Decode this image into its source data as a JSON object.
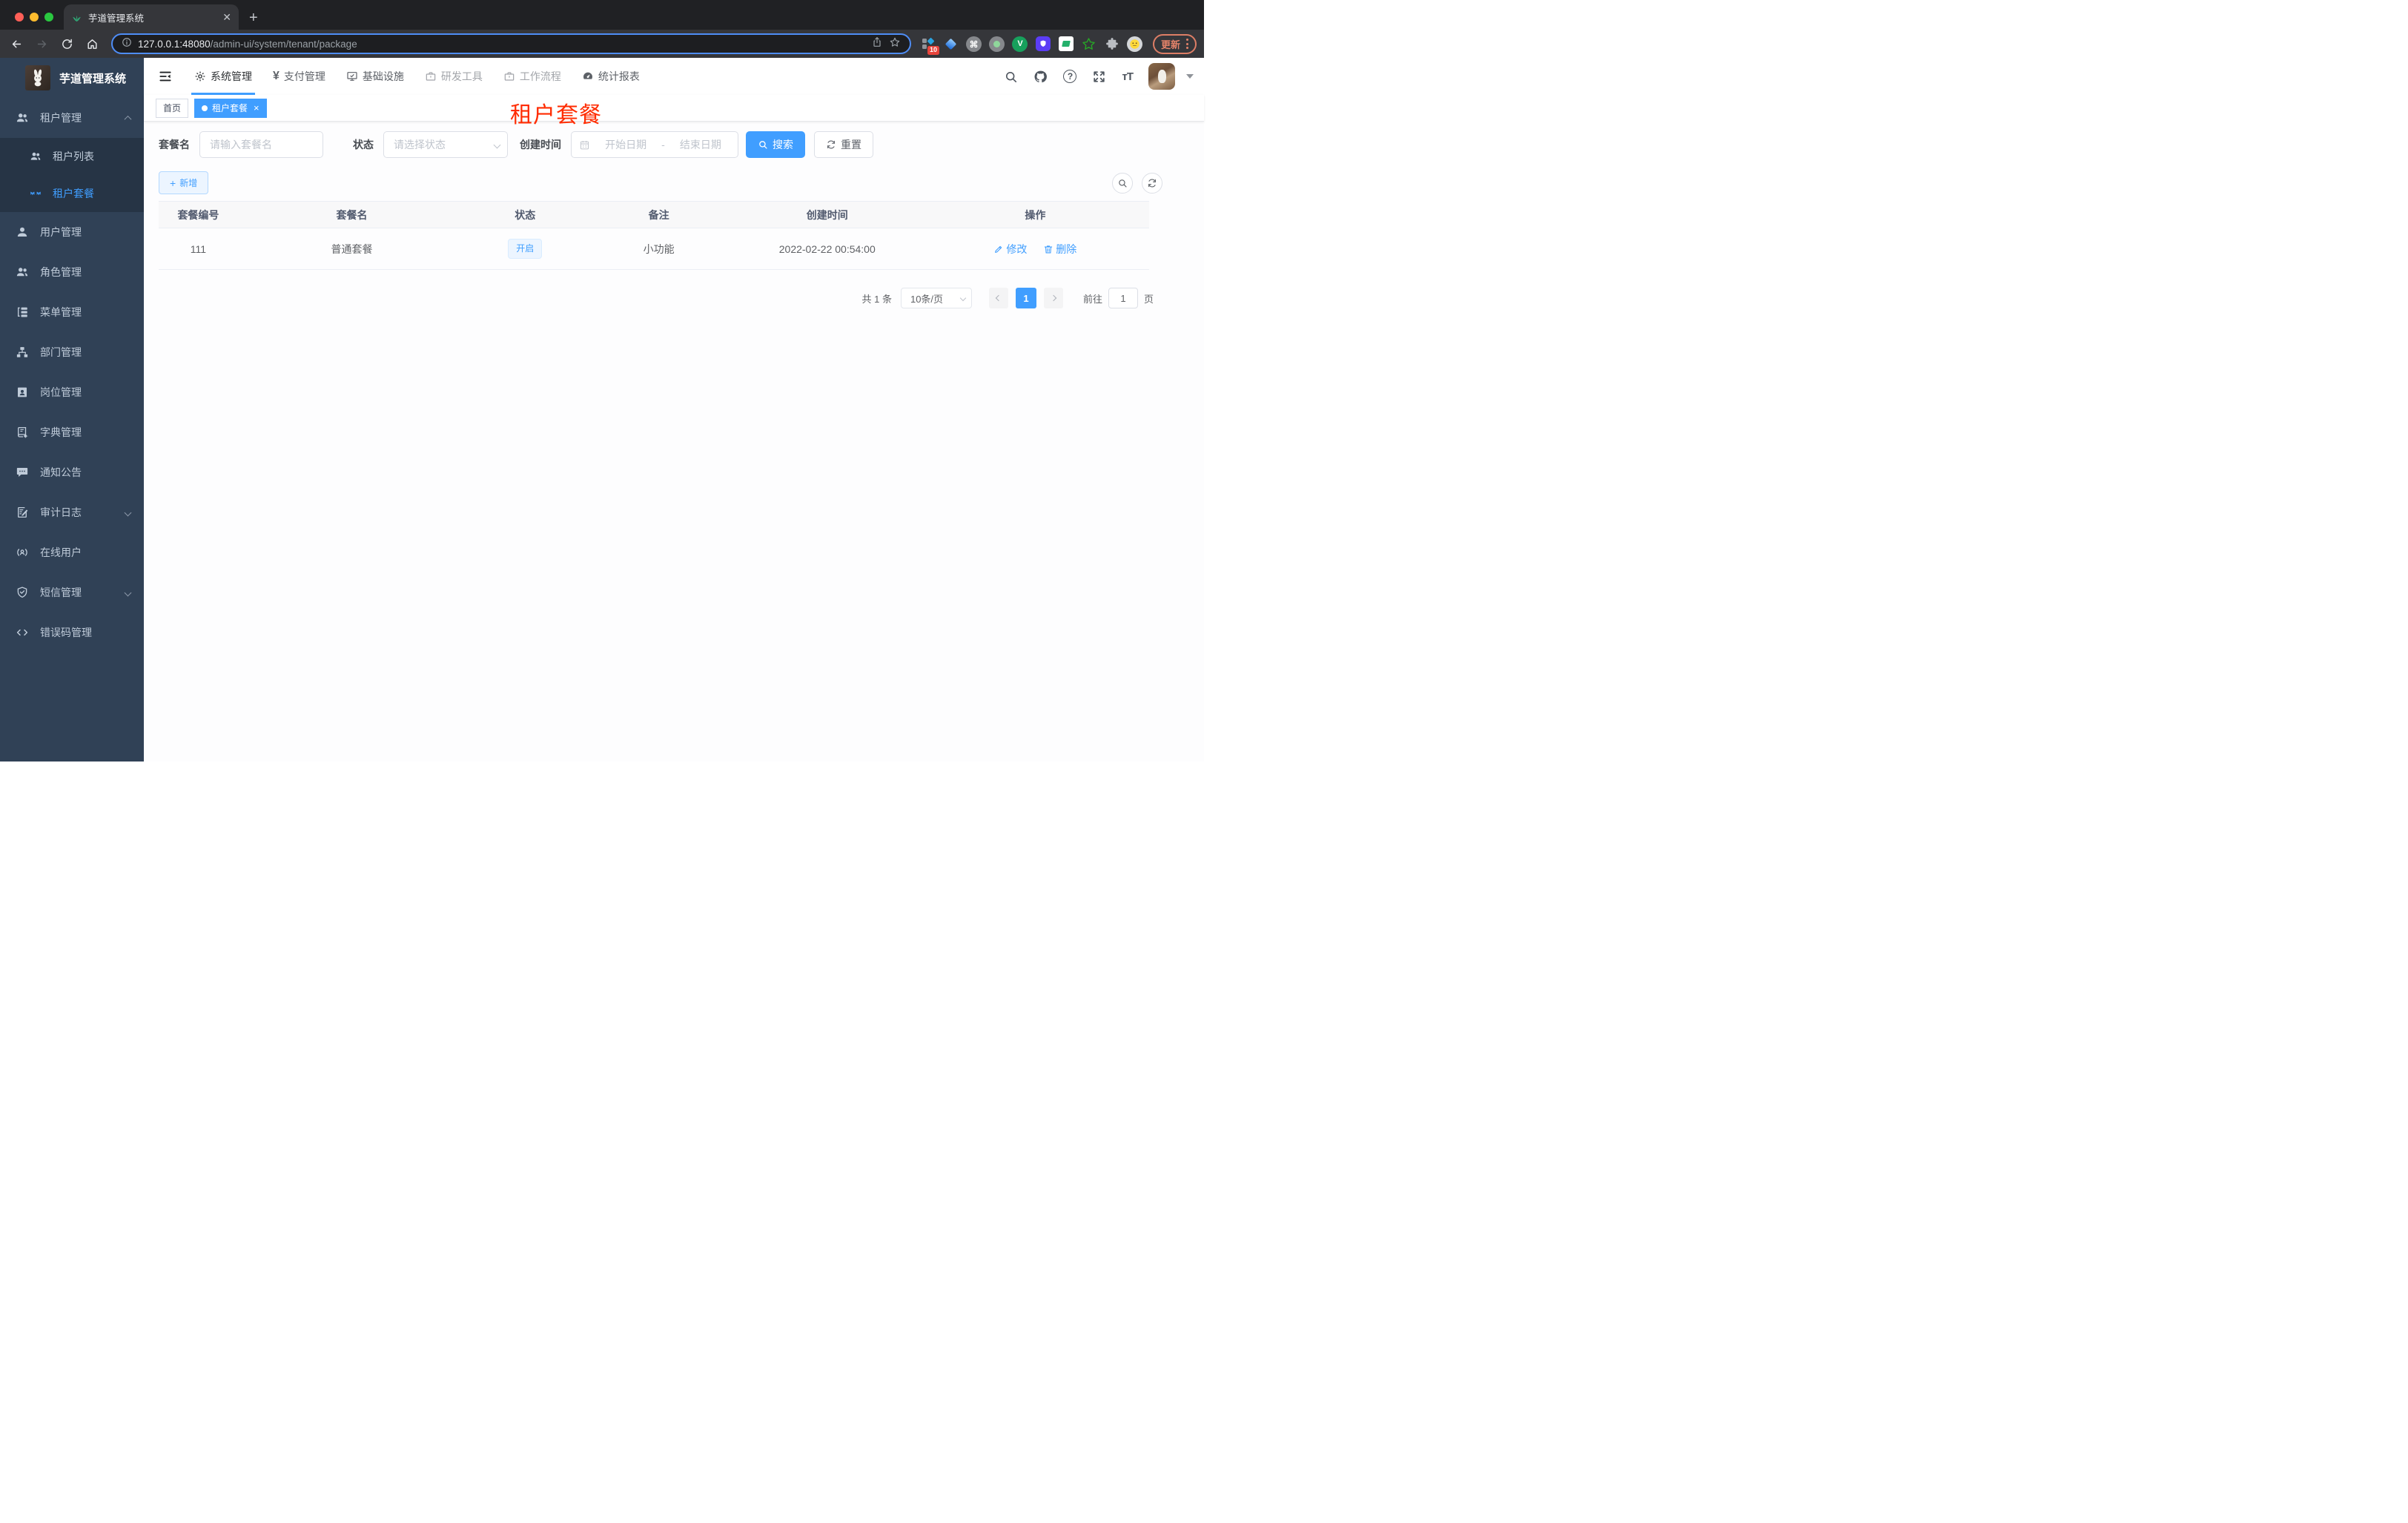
{
  "browser": {
    "tab_title": "芋道管理系统",
    "url_host": "127.0.0.1:48080",
    "url_path": "/admin-ui/system/tenant/package",
    "extension_badge": "10",
    "update_label": "更新"
  },
  "topnav": {
    "items": [
      {
        "label": "系统管理",
        "icon": "gear-icon",
        "active": true
      },
      {
        "label": "支付管理",
        "icon": "yen-icon"
      },
      {
        "label": "基础设施",
        "icon": "monitor-icon"
      },
      {
        "label": "研发工具",
        "icon": "toolbox-icon"
      },
      {
        "label": "工作流程",
        "icon": "workflow-icon"
      },
      {
        "label": "统计报表",
        "icon": "dashboard-icon"
      }
    ]
  },
  "sidebar": {
    "logo_title": "芋道管理系统",
    "items": [
      {
        "label": "租户管理",
        "icon": "users-icon",
        "expanded": true,
        "children": [
          {
            "label": "租户列表",
            "icon": "users-icon"
          },
          {
            "label": "租户套餐",
            "icon": "eyes-icon",
            "active": true
          }
        ]
      },
      {
        "label": "用户管理",
        "icon": "user-icon"
      },
      {
        "label": "角色管理",
        "icon": "roles-icon"
      },
      {
        "label": "菜单管理",
        "icon": "menu-tree-icon"
      },
      {
        "label": "部门管理",
        "icon": "org-icon"
      },
      {
        "label": "岗位管理",
        "icon": "post-icon"
      },
      {
        "label": "字典管理",
        "icon": "dict-icon"
      },
      {
        "label": "通知公告",
        "icon": "notice-icon"
      },
      {
        "label": "审计日志",
        "icon": "audit-icon",
        "has_children": true
      },
      {
        "label": "在线用户",
        "icon": "online-icon"
      },
      {
        "label": "短信管理",
        "icon": "sms-shield-icon",
        "has_children": true
      },
      {
        "label": "错误码管理",
        "icon": "code-icon"
      }
    ]
  },
  "tags": {
    "items": [
      {
        "label": "首页"
      },
      {
        "label": "租户套餐",
        "active": true,
        "closable": true
      }
    ]
  },
  "overlay_title": "租户套餐",
  "filters": {
    "package_name": {
      "label": "套餐名",
      "placeholder": "请输入套餐名"
    },
    "status": {
      "label": "状态",
      "placeholder": "请选择状态"
    },
    "create_time": {
      "label": "创建时间",
      "start_placeholder": "开始日期",
      "separator": "-",
      "end_placeholder": "结束日期"
    },
    "search_label": "搜索",
    "reset_label": "重置"
  },
  "toolbar": {
    "add_label": "新增"
  },
  "table": {
    "columns": [
      "套餐编号",
      "套餐名",
      "状态",
      "备注",
      "创建时间",
      "操作"
    ],
    "rows": [
      {
        "id": "111",
        "name": "普通套餐",
        "status": "开启",
        "remark": "小功能",
        "created_at": "2022-02-22 00:54:00",
        "action_edit": "修改",
        "action_delete": "删除"
      }
    ]
  },
  "pagination": {
    "total": "共 1 条",
    "page_size": "10条/页",
    "current": "1",
    "goto_label": "前往",
    "goto_value": "1",
    "page_unit": "页"
  },
  "colors": {
    "accent": "#409eff",
    "sidebar_bg": "#304156",
    "sidebar_submenu_bg": "#263445",
    "overlay_title_color": "#ff2b00",
    "status_tag_bg": "#ecf5ff",
    "update_button_color": "#e4836a",
    "traffic_lights": [
      "#ff5f57",
      "#febc2e",
      "#2ac840"
    ]
  }
}
